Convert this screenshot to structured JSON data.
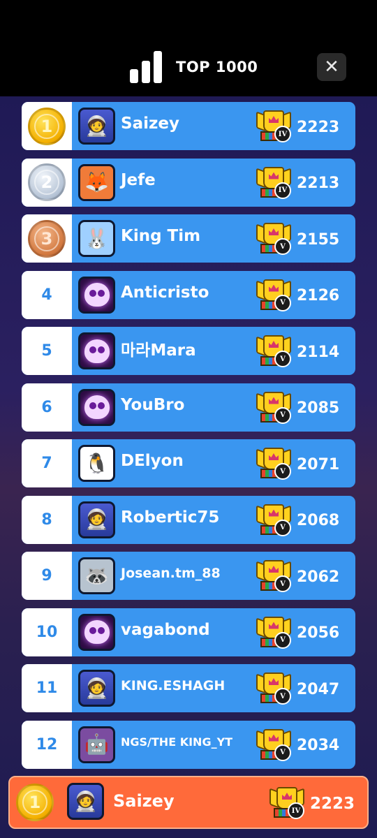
{
  "header": {
    "title": "TOP 1000",
    "close_label": "✕"
  },
  "rows": [
    {
      "rank": "1",
      "medal": "gold",
      "avatar": "astronaut-avatar",
      "name": "Saizey",
      "tier": "IV",
      "score": "2223"
    },
    {
      "rank": "2",
      "medal": "silver",
      "avatar": "fox-avatar",
      "name": "Jefe",
      "tier": "IV",
      "score": "2213"
    },
    {
      "rank": "3",
      "medal": "bronze",
      "avatar": "bunny-avatar",
      "name": "King Tim",
      "tier": "V",
      "score": "2155"
    },
    {
      "rank": "4",
      "medal": "",
      "avatar": "skull-avatar",
      "name": "Anticristo",
      "tier": "V",
      "score": "2126"
    },
    {
      "rank": "5",
      "medal": "",
      "avatar": "skull-avatar",
      "name": "마라Mara",
      "tier": "V",
      "score": "2114"
    },
    {
      "rank": "6",
      "medal": "",
      "avatar": "skull-avatar",
      "name": "YouBro",
      "tier": "V",
      "score": "2085"
    },
    {
      "rank": "7",
      "medal": "",
      "avatar": "penguin-avatar",
      "name": "DElyon",
      "tier": "V",
      "score": "2071"
    },
    {
      "rank": "8",
      "medal": "",
      "avatar": "astronaut-avatar",
      "name": "Robertic75",
      "tier": "V",
      "score": "2068"
    },
    {
      "rank": "9",
      "medal": "",
      "avatar": "raccoon-avatar",
      "name": "Josean.tm_88",
      "tier": "V",
      "score": "2062"
    },
    {
      "rank": "10",
      "medal": "",
      "avatar": "skull-avatar",
      "name": "vagabond",
      "tier": "V",
      "score": "2056"
    },
    {
      "rank": "11",
      "medal": "",
      "avatar": "astronaut-avatar",
      "name": "KING.ESHAGH",
      "tier": "V",
      "score": "2047"
    },
    {
      "rank": "12",
      "medal": "",
      "avatar": "robot-avatar",
      "name": "NGS/THE KING_YT",
      "tier": "V",
      "score": "2034"
    }
  ],
  "me": {
    "rank": "1",
    "medal": "gold",
    "avatar": "astronaut-avatar",
    "name": "Saizey",
    "tier": "IV",
    "score": "2223"
  },
  "colors": {
    "row_bg": "#3a96f0",
    "rank_text": "#2f8ae8",
    "me_bg": "#ff6a3a",
    "header_bg": "#000000"
  }
}
